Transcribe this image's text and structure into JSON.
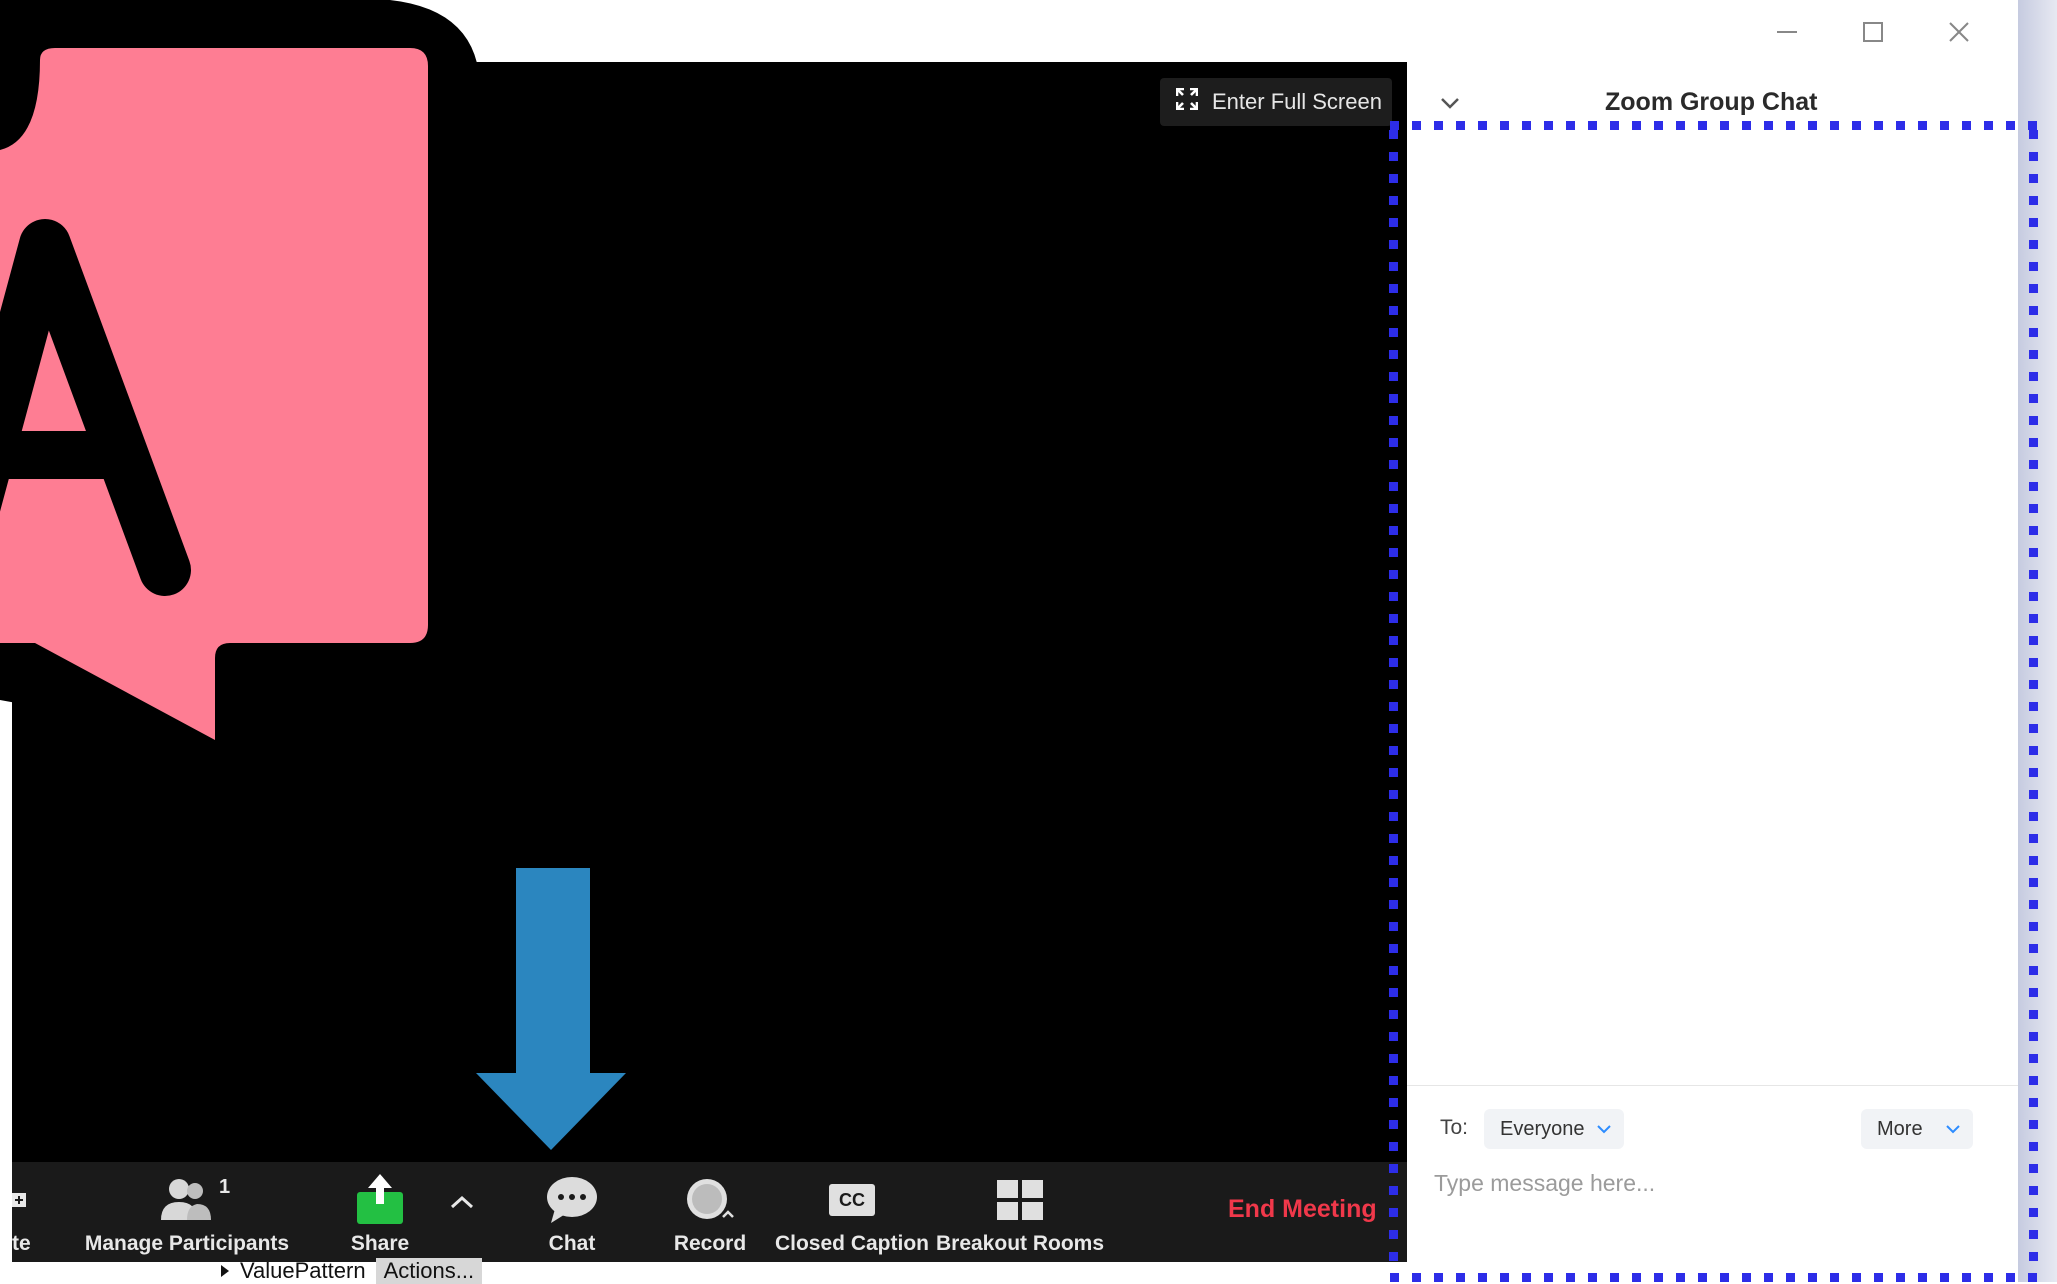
{
  "window": {
    "controls": [
      "minimize-icon",
      "maximize-icon",
      "close-icon"
    ]
  },
  "video": {
    "enter_full_screen": "Enter Full Screen",
    "logo_letter": "A"
  },
  "toolbar": {
    "partial_label": "te",
    "participants_label": "Manage Participants",
    "participants_count": "1",
    "share_label": "Share",
    "chat_label": "Chat",
    "record_label": "Record",
    "cc_label": "Closed Caption",
    "cc_badge": "CC",
    "breakout_label": "Breakout Rooms",
    "end_label": "End Meeting"
  },
  "chat": {
    "title": "Zoom Group Chat",
    "to_label": "To:",
    "to_value": "Everyone",
    "more_label": "More",
    "input_placeholder": "Type message here..."
  },
  "background_window": {
    "tree_item": "ValuePattern",
    "actions_label": "Actions..."
  },
  "colors": {
    "highlight": "#2d2de8",
    "end_meeting": "#f0384a",
    "share_green": "#23c043",
    "logo_pink": "#fe7d93",
    "arrow_blue": "#2b86bf"
  }
}
